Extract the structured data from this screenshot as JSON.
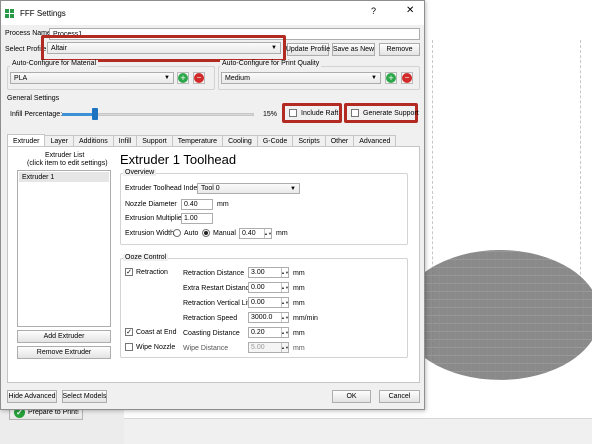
{
  "dialog": {
    "title": "FFF Settings",
    "help_glyph": "?",
    "close_glyph": "✕"
  },
  "process_name": {
    "label": "Process Name",
    "value": "Process1"
  },
  "select_profile": {
    "label": "Select Profile",
    "value": "Altair"
  },
  "profile_buttons": {
    "update": "Update Profile",
    "save_as_new": "Save as New",
    "remove": "Remove"
  },
  "auto_material": {
    "title": "Auto-Configure for Material",
    "value": "PLA"
  },
  "auto_quality": {
    "title": "Auto-Configure for Print Quality",
    "value": "Medium"
  },
  "general_settings": {
    "title": "General Settings",
    "infill_label": "Infill Percentage:",
    "infill_value": "15%",
    "infill_fraction": 0.15,
    "include_raft": "Include Raft",
    "generate_support": "Generate Support"
  },
  "tabs": [
    "Extruder",
    "Layer",
    "Additions",
    "Infill",
    "Support",
    "Temperature",
    "Cooling",
    "G-Code",
    "Scripts",
    "Other",
    "Advanced"
  ],
  "extruder_list": {
    "header_line1": "Extruder List",
    "header_line2": "(click item to edit settings)",
    "items": [
      "Extruder 1"
    ],
    "add_button": "Add Extruder",
    "remove_button": "Remove Extruder"
  },
  "toolhead": {
    "heading": "Extruder 1 Toolhead",
    "overview_title": "Overview",
    "index_label": "Extruder Toolhead Index",
    "index_value": "Tool 0",
    "nozzle_label": "Nozzle Diameter",
    "nozzle_value": "0.40",
    "nozzle_unit": "mm",
    "multiplier_label": "Extrusion Multiplier",
    "multiplier_value": "1.00",
    "width_label": "Extrusion Width",
    "width_auto": "Auto",
    "width_manual": "Manual",
    "width_value": "0.40",
    "width_unit": "mm"
  },
  "ooze": {
    "title": "Ooze Control",
    "retraction_label": "Retraction",
    "retraction_distance_label": "Retraction Distance",
    "retraction_distance_value": "3.00",
    "extra_restart_label": "Extra Restart Distance",
    "extra_restart_value": "0.00",
    "vertical_lift_label": "Retraction Vertical Lift",
    "vertical_lift_value": "0.00",
    "retraction_speed_label": "Retraction Speed",
    "retraction_speed_value": "3000.0",
    "retraction_speed_unit": "mm/min",
    "coast_label": "Coast at End",
    "coasting_distance_label": "Coasting Distance",
    "coasting_distance_value": "0.20",
    "wipe_label": "Wipe Nozzle",
    "wipe_distance_label": "Wipe Distance",
    "wipe_distance_value": "5.00",
    "mm": "mm"
  },
  "footer": {
    "hide_advanced": "Hide Advanced",
    "select_models": "Select Models",
    "ok": "OK",
    "cancel": "Cancel"
  },
  "background": {
    "prepare_button": "Prepare to Print!"
  },
  "colors": {
    "highlight": "#b22a22",
    "accent": "#1e73c0",
    "plus": "#2ea84a",
    "minus": "#d22b2b"
  }
}
